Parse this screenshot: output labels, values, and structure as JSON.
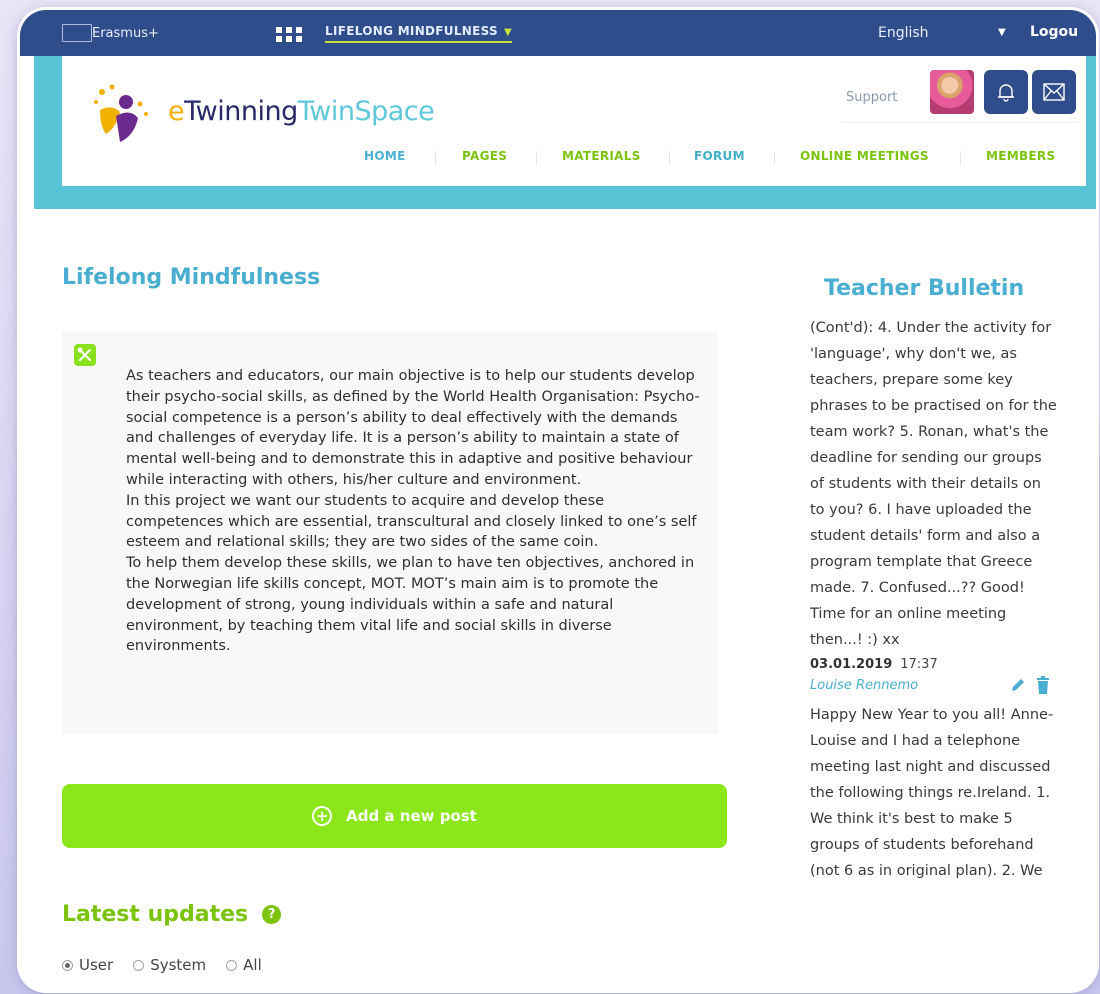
{
  "topbar": {
    "erasmus_label": "Erasmus+",
    "project_label": "LIFELONG MINDFULNESS",
    "language": "English",
    "logout_label": "Logou"
  },
  "header": {
    "brand_prefix": "e",
    "brand_main": "Twinning",
    "brand_suffix": "TwinSpace",
    "support_label": "Support",
    "nav": [
      {
        "label": "HOME"
      },
      {
        "label": "PAGES"
      },
      {
        "label": "MATERIALS"
      },
      {
        "label": "FORUM"
      },
      {
        "label": "ONLINE MEETINGS"
      },
      {
        "label": "MEMBERS"
      }
    ]
  },
  "main": {
    "title": "Lifelong Mindfulness",
    "description": [
      "As teachers and educators, our main objective is to help our students develop their psycho-social skills, as defined by the World Health Organisation: Psycho-social competence is a person’s ability to deal effectively with the demands and challenges of everyday life. It is a person’s ability to maintain a state of mental well-being and to demonstrate this in adaptive and positive behaviour while interacting with others, his/her culture and environment.",
      "In this project we want our students to acquire and develop these competences which are essential, transcultural and closely linked to one’s self esteem and relational skills; they are two sides of the same coin.",
      "To help them develop these skills, we plan to have ten objectives, anchored in the Norwegian life skills concept, MOT. MOT’s main aim is to promote the development of strong, young individuals within a safe and natural environment, by teaching them vital life and social skills in diverse environments."
    ],
    "add_post_label": "Add a new post",
    "latest_updates_title": "Latest updates",
    "filters": [
      {
        "label": "User",
        "checked": true
      },
      {
        "label": "System",
        "checked": false
      },
      {
        "label": "All",
        "checked": false
      }
    ]
  },
  "sidebar": {
    "title": "Teacher Bulletin",
    "post1_text": "(Cont'd): 4. Under the activity for 'language', why don't we, as teachers, prepare some key phrases to be practised on for the team work? 5. Ronan, what's the deadline for sending our groups of students with their details on to you? 6. I have uploaded the student details' form and also a program template that Greece made. 7. Confused...?? Good! Time for an online meeting then...! :) xx",
    "post2_date": "03.01.2019",
    "post2_time": "17:37",
    "post2_author": "Louise Rennemo",
    "post2_text": "Happy New Year to you all! Anne-Louise and I had a telephone meeting last night and discussed the following things re.Ireland. 1. We think it's best to make 5 groups of students beforehand (not 6 as in original plan). 2. We"
  },
  "colors": {
    "topbar": "#2f4d8a",
    "teal_band": "#58c3d5",
    "accent_green": "#8be61a",
    "title_blue": "#4aaed0"
  }
}
